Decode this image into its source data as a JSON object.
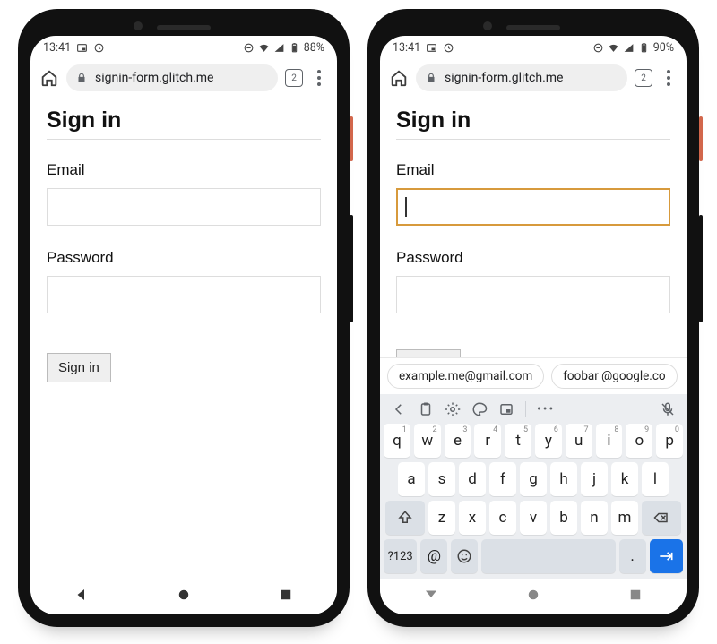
{
  "status_time": "13:41",
  "phone1": {
    "battery": "88%"
  },
  "phone2": {
    "battery": "90%"
  },
  "url": "signin-form.glitch.me",
  "tab_count": "2",
  "page": {
    "heading": "Sign in",
    "email_label": "Email",
    "password_label": "Password",
    "submit_label": "Sign in"
  },
  "suggestions": [
    "example.me@gmail.com",
    "foobar @google.co"
  ],
  "keyboard": {
    "row1": [
      {
        "k": "q",
        "n": "1"
      },
      {
        "k": "w",
        "n": "2"
      },
      {
        "k": "e",
        "n": "3"
      },
      {
        "k": "r",
        "n": "4"
      },
      {
        "k": "t",
        "n": "5"
      },
      {
        "k": "y",
        "n": "6"
      },
      {
        "k": "u",
        "n": "7"
      },
      {
        "k": "i",
        "n": "8"
      },
      {
        "k": "o",
        "n": "9"
      },
      {
        "k": "p",
        "n": "0"
      }
    ],
    "row2": [
      "a",
      "s",
      "d",
      "f",
      "g",
      "h",
      "j",
      "k",
      "l"
    ],
    "row3": [
      "z",
      "x",
      "c",
      "v",
      "b",
      "n",
      "m"
    ],
    "sym": "?123",
    "at": "@",
    "period": "."
  }
}
